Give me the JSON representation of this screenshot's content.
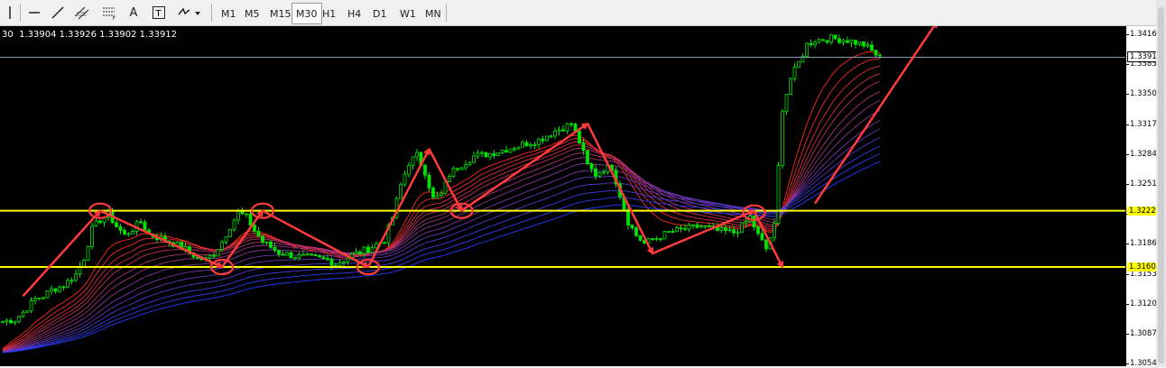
{
  "toolbar": {
    "tools": [
      {
        "name": "cursor-tool-icon"
      },
      {
        "name": "horizontal-line-tool-icon"
      },
      {
        "name": "trendline-tool-icon"
      },
      {
        "name": "equidistant-channel-tool-icon"
      },
      {
        "name": "fibonacci-tool-icon"
      },
      {
        "name": "text-tool-icon",
        "label": "A"
      },
      {
        "name": "text-label-tool-icon"
      },
      {
        "name": "arrows-tool-icon"
      }
    ],
    "timeframes": [
      "M1",
      "M5",
      "M15",
      "M30",
      "H1",
      "H4",
      "D1",
      "W1",
      "MN"
    ],
    "active_timeframe": "M30"
  },
  "info_line": "30  1.33904 1.33926 1.33902 1.33912",
  "axis": {
    "ticks": [
      "1.34165",
      "1.33835",
      "1.33505",
      "1.33175",
      "1.32845",
      "1.32515",
      "1.32190",
      "1.31860",
      "1.31530",
      "1.31200",
      "1.30870",
      "1.30540"
    ],
    "current_price": "1.33912",
    "level_high": "1.32220",
    "level_low": "1.31600"
  },
  "colors": {
    "background": "#000000",
    "candles": "#00e400",
    "levels": "#ffff00",
    "arrows": "#ff3b3b",
    "ribbon_warm": "#ff2a1a",
    "ribbon_cool": "#1e3cff",
    "current_line": "#8a97b0"
  },
  "chart_data": {
    "type": "line",
    "instrument_info": "30 1.33904 1.33926 1.33902 1.33912",
    "ylim": [
      1.3054,
      1.3428
    ],
    "price_path": [
      [
        0,
        1.31
      ],
      [
        3,
        1.3102
      ],
      [
        5,
        1.311
      ],
      [
        8,
        1.3125
      ],
      [
        10,
        1.3128
      ],
      [
        12,
        1.3135
      ],
      [
        15,
        1.314
      ],
      [
        18,
        1.3152
      ],
      [
        20,
        1.317
      ],
      [
        22,
        1.3202
      ],
      [
        24,
        1.3212
      ],
      [
        26,
        1.3218
      ],
      [
        28,
        1.3205
      ],
      [
        30,
        1.3195
      ],
      [
        32,
        1.3202
      ],
      [
        34,
        1.321
      ],
      [
        36,
        1.3196
      ],
      [
        40,
        1.319
      ],
      [
        44,
        1.3182
      ],
      [
        48,
        1.317
      ],
      [
        50,
        1.3168
      ],
      [
        52,
        1.3175
      ],
      [
        54,
        1.3188
      ],
      [
        56,
        1.3205
      ],
      [
        58,
        1.322
      ],
      [
        60,
        1.3215
      ],
      [
        62,
        1.32
      ],
      [
        64,
        1.3188
      ],
      [
        68,
        1.3176
      ],
      [
        72,
        1.3172
      ],
      [
        76,
        1.317
      ],
      [
        80,
        1.3168
      ],
      [
        82,
        1.3163
      ],
      [
        84,
        1.3168
      ],
      [
        86,
        1.3173
      ],
      [
        90,
        1.318
      ],
      [
        94,
        1.319
      ],
      [
        96,
        1.3215
      ],
      [
        98,
        1.325
      ],
      [
        100,
        1.3275
      ],
      [
        102,
        1.3283
      ],
      [
        104,
        1.3265
      ],
      [
        106,
        1.3235
      ],
      [
        108,
        1.324
      ],
      [
        110,
        1.3262
      ],
      [
        112,
        1.327
      ],
      [
        116,
        1.3282
      ],
      [
        120,
        1.3285
      ],
      [
        124,
        1.329
      ],
      [
        128,
        1.3295
      ],
      [
        132,
        1.33
      ],
      [
        136,
        1.331
      ],
      [
        140,
        1.3318
      ],
      [
        142,
        1.3298
      ],
      [
        144,
        1.3272
      ],
      [
        146,
        1.3262
      ],
      [
        148,
        1.3268
      ],
      [
        150,
        1.327
      ],
      [
        152,
        1.324
      ],
      [
        154,
        1.321
      ],
      [
        156,
        1.3195
      ],
      [
        158,
        1.3186
      ],
      [
        160,
        1.319
      ],
      [
        164,
        1.3198
      ],
      [
        168,
        1.3202
      ],
      [
        172,
        1.3205
      ],
      [
        176,
        1.32
      ],
      [
        180,
        1.3198
      ],
      [
        182,
        1.3205
      ],
      [
        184,
        1.3215
      ],
      [
        186,
        1.3195
      ],
      [
        188,
        1.318
      ],
      [
        190,
        1.3205
      ],
      [
        192,
        1.3335
      ],
      [
        194,
        1.3368
      ],
      [
        196,
        1.3385
      ],
      [
        198,
        1.3405
      ],
      [
        200,
        1.341
      ],
      [
        204,
        1.3412
      ],
      [
        208,
        1.341
      ],
      [
        212,
        1.3405
      ],
      [
        216,
        1.3391
      ]
    ],
    "horizontal_levels": [
      1.3222,
      1.316
    ],
    "current_price": 1.33912,
    "circled_points": [
      [
        24,
        1.3222
      ],
      [
        54,
        1.316
      ],
      [
        64,
        1.3222
      ],
      [
        90,
        1.316
      ],
      [
        113,
        1.3222
      ],
      [
        185,
        1.322
      ]
    ],
    "annotation_arrows": [
      [
        [
          5,
          1.3128
        ],
        [
          24,
          1.3222
        ]
      ],
      [
        [
          24,
          1.3222
        ],
        [
          54,
          1.316
        ]
      ],
      [
        [
          54,
          1.316
        ],
        [
          64,
          1.3222
        ]
      ],
      [
        [
          64,
          1.3222
        ],
        [
          90,
          1.316
        ]
      ],
      [
        [
          90,
          1.316
        ],
        [
          105,
          1.329
        ]
      ],
      [
        [
          105,
          1.329
        ],
        [
          113,
          1.3222
        ]
      ],
      [
        [
          113,
          1.3222
        ],
        [
          144,
          1.3318
        ]
      ],
      [
        [
          144,
          1.3318
        ],
        [
          160,
          1.3175
        ]
      ],
      [
        [
          160,
          1.3175
        ],
        [
          185,
          1.3222
        ]
      ],
      [
        [
          185,
          1.3222
        ],
        [
          192,
          1.316
        ]
      ],
      [
        [
          200,
          1.323
        ],
        [
          230,
          1.343
        ]
      ]
    ]
  }
}
